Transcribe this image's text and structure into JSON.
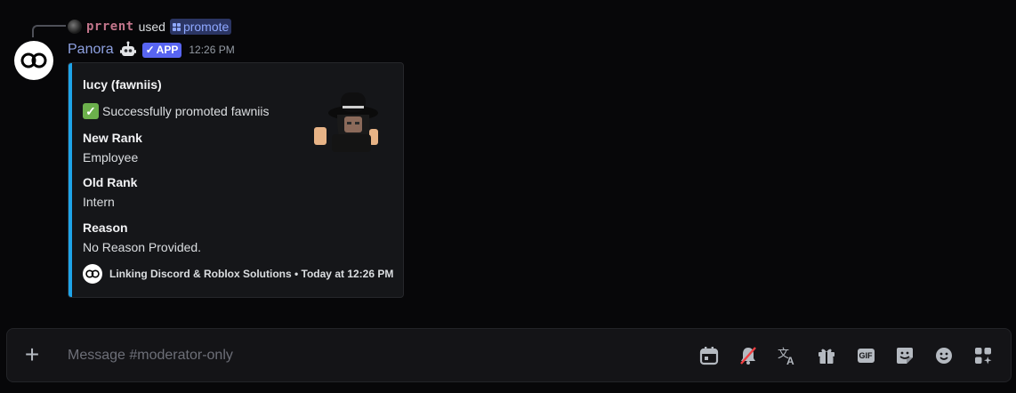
{
  "reply": {
    "username": "prrent",
    "used_text": "used",
    "command": "promote"
  },
  "message": {
    "author": "Panora",
    "app_badge": "APP",
    "timestamp": "12:26 PM"
  },
  "embed": {
    "title": "lucy (fawniis)",
    "description": "Successfully promoted fawniis",
    "fields": [
      {
        "name": "New Rank",
        "value": "Employee"
      },
      {
        "name": "Old Rank",
        "value": "Intern"
      },
      {
        "name": "Reason",
        "value": "No Reason Provided."
      }
    ],
    "footer": "Linking Discord & Roblox Solutions • Today at 12:26 PM",
    "accent_color": "#1ea4e9"
  },
  "composer": {
    "placeholder": "Message #moderator-only",
    "gif_label": "GIF"
  },
  "colors": {
    "background": "#070709",
    "username": "#8ea1e1",
    "app_badge": "#5865f2",
    "reply_user": "#c2758b"
  }
}
